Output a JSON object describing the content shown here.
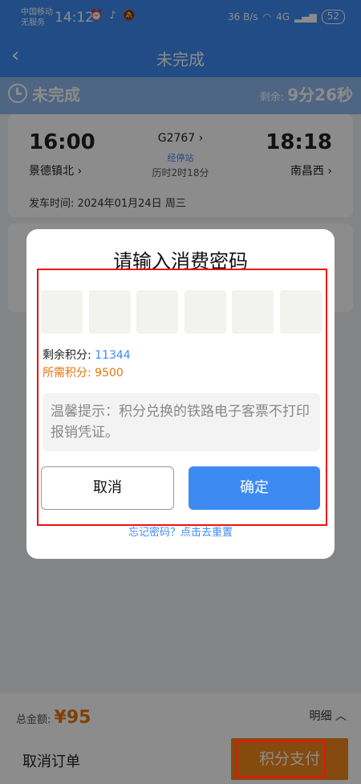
{
  "status_bar": {
    "carrier_line1": "中国移动",
    "carrier_line2": "无服务",
    "time": "14:12",
    "left_icons": "⏰ ♪ 🔕",
    "network": "36 B/s",
    "signal": "4G",
    "battery": "52"
  },
  "header": {
    "back": "‹",
    "title": "未完成"
  },
  "countdown": {
    "title": "未完成",
    "remain_label": "剩余:",
    "remain_value": "9分26秒"
  },
  "ticket": {
    "depart_time": "16:00",
    "depart_station": "景德镇北 ›",
    "train_no": "G2767 ›",
    "via": "经停站",
    "duration": "历时2时18分",
    "arrive_time": "18:18",
    "arrive_station": "南昌西 ›",
    "date_label": "发车时间: 2024年01月24日 周三"
  },
  "dialog": {
    "title": "请输入消费密码",
    "remaining_label": "剩余积分:",
    "remaining_value": "11344",
    "needed_label": "所需积分:",
    "needed_value": "9500",
    "tip": "温馨提示：积分兑换的铁路电子客票不打印报销凭证。",
    "cancel": "取消",
    "confirm": "确定",
    "forgot": "忘记密码？点击去重置"
  },
  "bottom": {
    "total_label": "总金额:",
    "total_value": "¥95",
    "detail": "明细 ︿",
    "cancel_order": "取消订单",
    "pay": "积分支付"
  },
  "colors": {
    "primary": "#3d8bf2",
    "accent": "#f0881a",
    "highlight": "#e11111"
  }
}
